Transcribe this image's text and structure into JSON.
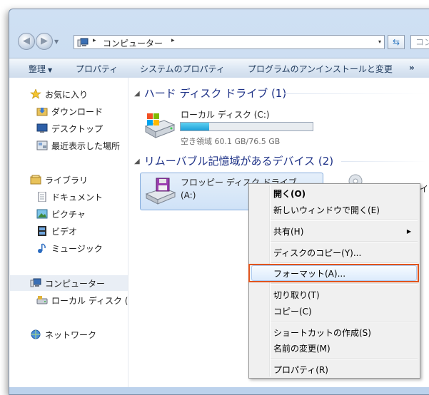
{
  "navigation": {
    "back_glyph": "◀",
    "forward_glyph": "▶",
    "dropdown_glyph": "▼",
    "address": {
      "crumb": "コンピューター",
      "separator": "▸",
      "drop_glyph": "▾"
    },
    "refresh_glyph": "⇆",
    "search_placeholder": "コンピュ"
  },
  "toolbar": {
    "organize_label": "整理",
    "organize_arrow": "▼",
    "properties_label": "プロパティ",
    "system_properties_label": "システムのプロパティ",
    "uninstall_label": "プログラムのアンインストールと変更",
    "more_label": "»"
  },
  "sidebar": {
    "favorites": {
      "label": "お気に入り",
      "icon": "star-icon"
    },
    "downloads": {
      "label": "ダウンロード",
      "icon": "downloads-folder-icon"
    },
    "desktop": {
      "label": "デスクトップ",
      "icon": "desktop-icon"
    },
    "recent": {
      "label": "最近表示した場所",
      "icon": "recent-places-icon"
    },
    "libraries": {
      "label": "ライブラリ",
      "icon": "library-icon"
    },
    "documents": {
      "label": "ドキュメント",
      "icon": "document-icon"
    },
    "pictures": {
      "label": "ピクチャ",
      "icon": "pictures-icon"
    },
    "videos": {
      "label": "ビデオ",
      "icon": "video-icon"
    },
    "music": {
      "label": "ミュージック",
      "icon": "music-icon"
    },
    "computer": {
      "label": "コンピューター",
      "icon": "computer-icon"
    },
    "local_disk": {
      "label": "ローカル ディスク (",
      "icon": "hard-drive-icon"
    },
    "network": {
      "label": "ネットワーク",
      "icon": "network-icon"
    }
  },
  "main": {
    "hdd_group": {
      "chevron": "◢",
      "title": "ハード ディスク ドライブ (1)"
    },
    "local_drive": {
      "name": "ローカル ディスク (C:)",
      "free_text": "空き領域 60.1 GB/76.5 GB",
      "free_gb": 60.1,
      "total_gb": 76.5,
      "used_fraction": 0.214,
      "bar_color": "#1ea0d8"
    },
    "removable_group": {
      "chevron": "◢",
      "title": "リムーバブル記憶域があるデバイス (2)"
    },
    "floppy": {
      "name": "フロッピー ディスク ドライブ",
      "letter": "(A:)"
    },
    "other_drive_partial": "イブ"
  },
  "context_menu": {
    "items": {
      "open": "開く(O)",
      "open_new_window": "新しいウィンドウで開く(E)",
      "share": "共有(H)",
      "share_arrow": "▶",
      "disk_copy": "ディスクのコピー(Y)...",
      "format": "フォーマット(A)...",
      "cut": "切り取り(T)",
      "copy": "コピー(C)",
      "create_shortcut": "ショートカットの作成(S)",
      "rename": "名前の変更(M)",
      "properties": "プロパティ(R)"
    },
    "highlight_color": "#e0541d"
  }
}
